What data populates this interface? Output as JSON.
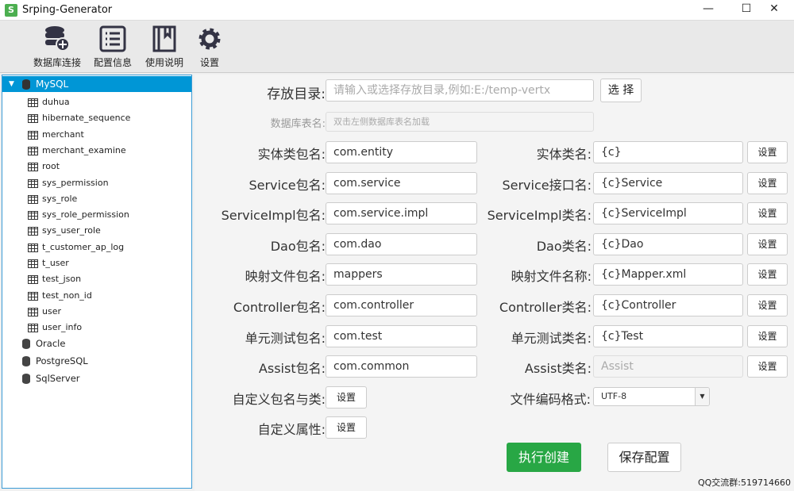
{
  "window": {
    "title": "Srping-Generator",
    "minimize": "—",
    "maximize": "☐",
    "close": "✕"
  },
  "toolbar": [
    "数据库连接",
    "配置信息",
    "使用说明",
    "设置"
  ],
  "tree": {
    "root": "MySQL",
    "tables": [
      "duhua",
      "hibernate_sequence",
      "merchant",
      "merchant_examine",
      "root",
      "sys_permission",
      "sys_role",
      "sys_role_permission",
      "sys_user_role",
      "t_customer_ap_log",
      "t_user",
      "test_json",
      "test_non_id",
      "user",
      "user_info"
    ],
    "others": [
      "Oracle",
      "PostgreSQL",
      "SqlServer"
    ]
  },
  "form": {
    "dir_label": "存放目录:",
    "dir_placeholder": "请输入或选择存放目录,例如:E:/temp-vertx",
    "choose": "选 择",
    "table_label": "数据库表名:",
    "table_placeholder": "双击左侧数据库表名加载",
    "rows": [
      {
        "l": "实体类包名:",
        "v": "com.entity",
        "rl": "实体类名:",
        "rv": "{c}"
      },
      {
        "l": "Service包名:",
        "v": "com.service",
        "rl": "Service接口名:",
        "rv": "{c}Service"
      },
      {
        "l": "ServiceImpl包名:",
        "v": "com.service.impl",
        "rl": "ServiceImpl类名:",
        "rv": "{c}ServiceImpl"
      },
      {
        "l": "Dao包名:",
        "v": "com.dao",
        "rl": "Dao类名:",
        "rv": "{c}Dao"
      },
      {
        "l": "映射文件包名:",
        "v": "mappers",
        "rl": "映射文件名称:",
        "rv": "{c}Mapper.xml"
      },
      {
        "l": "Controller包名:",
        "v": "com.controller",
        "rl": "Controller类名:",
        "rv": "{c}Controller"
      },
      {
        "l": "单元测试包名:",
        "v": "com.test",
        "rl": "单元测试类名:",
        "rv": "{c}Test"
      },
      {
        "l": "Assist包名:",
        "v": "com.common",
        "rl": "Assist类名:",
        "rv": "Assist"
      }
    ],
    "settings": "设置",
    "custom_pkg": "自定义包名与类:",
    "custom_attr": "自定义属性:",
    "encoding_label": "文件编码格式:",
    "encoding": "UTF-8",
    "run": "执行创建",
    "save": "保存配置"
  },
  "footer": "QQ交流群:519714660",
  "colors": {
    "accent": "#0096d6",
    "run": "#28a745"
  }
}
